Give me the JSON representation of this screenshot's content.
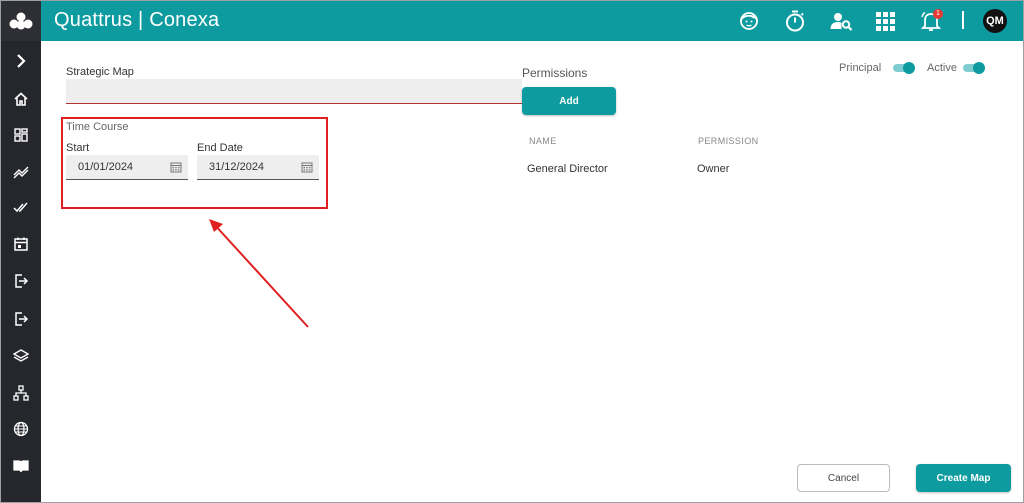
{
  "header": {
    "app_title": "Quattrus | Conexa",
    "icons": [
      "support-agent-icon",
      "stopwatch-icon",
      "user-search-icon",
      "apps-grid-icon",
      "bell-icon"
    ],
    "notification_count": "1",
    "avatar_initials": "QM"
  },
  "sidebar": {
    "icons": [
      "expand-chevron-icon",
      "home-icon",
      "dashboard-icon",
      "trend-icon",
      "double-check-icon",
      "calendar-icon",
      "login-icon",
      "logout-icon",
      "layers-icon",
      "hierarchy-icon",
      "globe-icon",
      "book-icon"
    ]
  },
  "form": {
    "strategic_map_label": "Strategic Map",
    "strategic_map_value": "",
    "time_course_label": "Time Course",
    "start_label": "Start",
    "start_value": "01/01/2024",
    "end_label": "End Date",
    "end_value": "31/12/2024"
  },
  "permissions": {
    "title": "Permissions",
    "add_label": "Add",
    "columns": [
      "NAME",
      "PERMISSION"
    ],
    "rows": [
      {
        "name": "General Director",
        "permission": "Owner"
      }
    ]
  },
  "toggles": {
    "principal_label": "Principal",
    "principal_on": true,
    "active_label": "Active",
    "active_on": true
  },
  "footer": {
    "cancel_label": "Cancel",
    "create_label": "Create Map"
  },
  "colors": {
    "brand": "#0e9ba0",
    "sidebar_bg": "#25272c",
    "highlight": "#e02020"
  }
}
